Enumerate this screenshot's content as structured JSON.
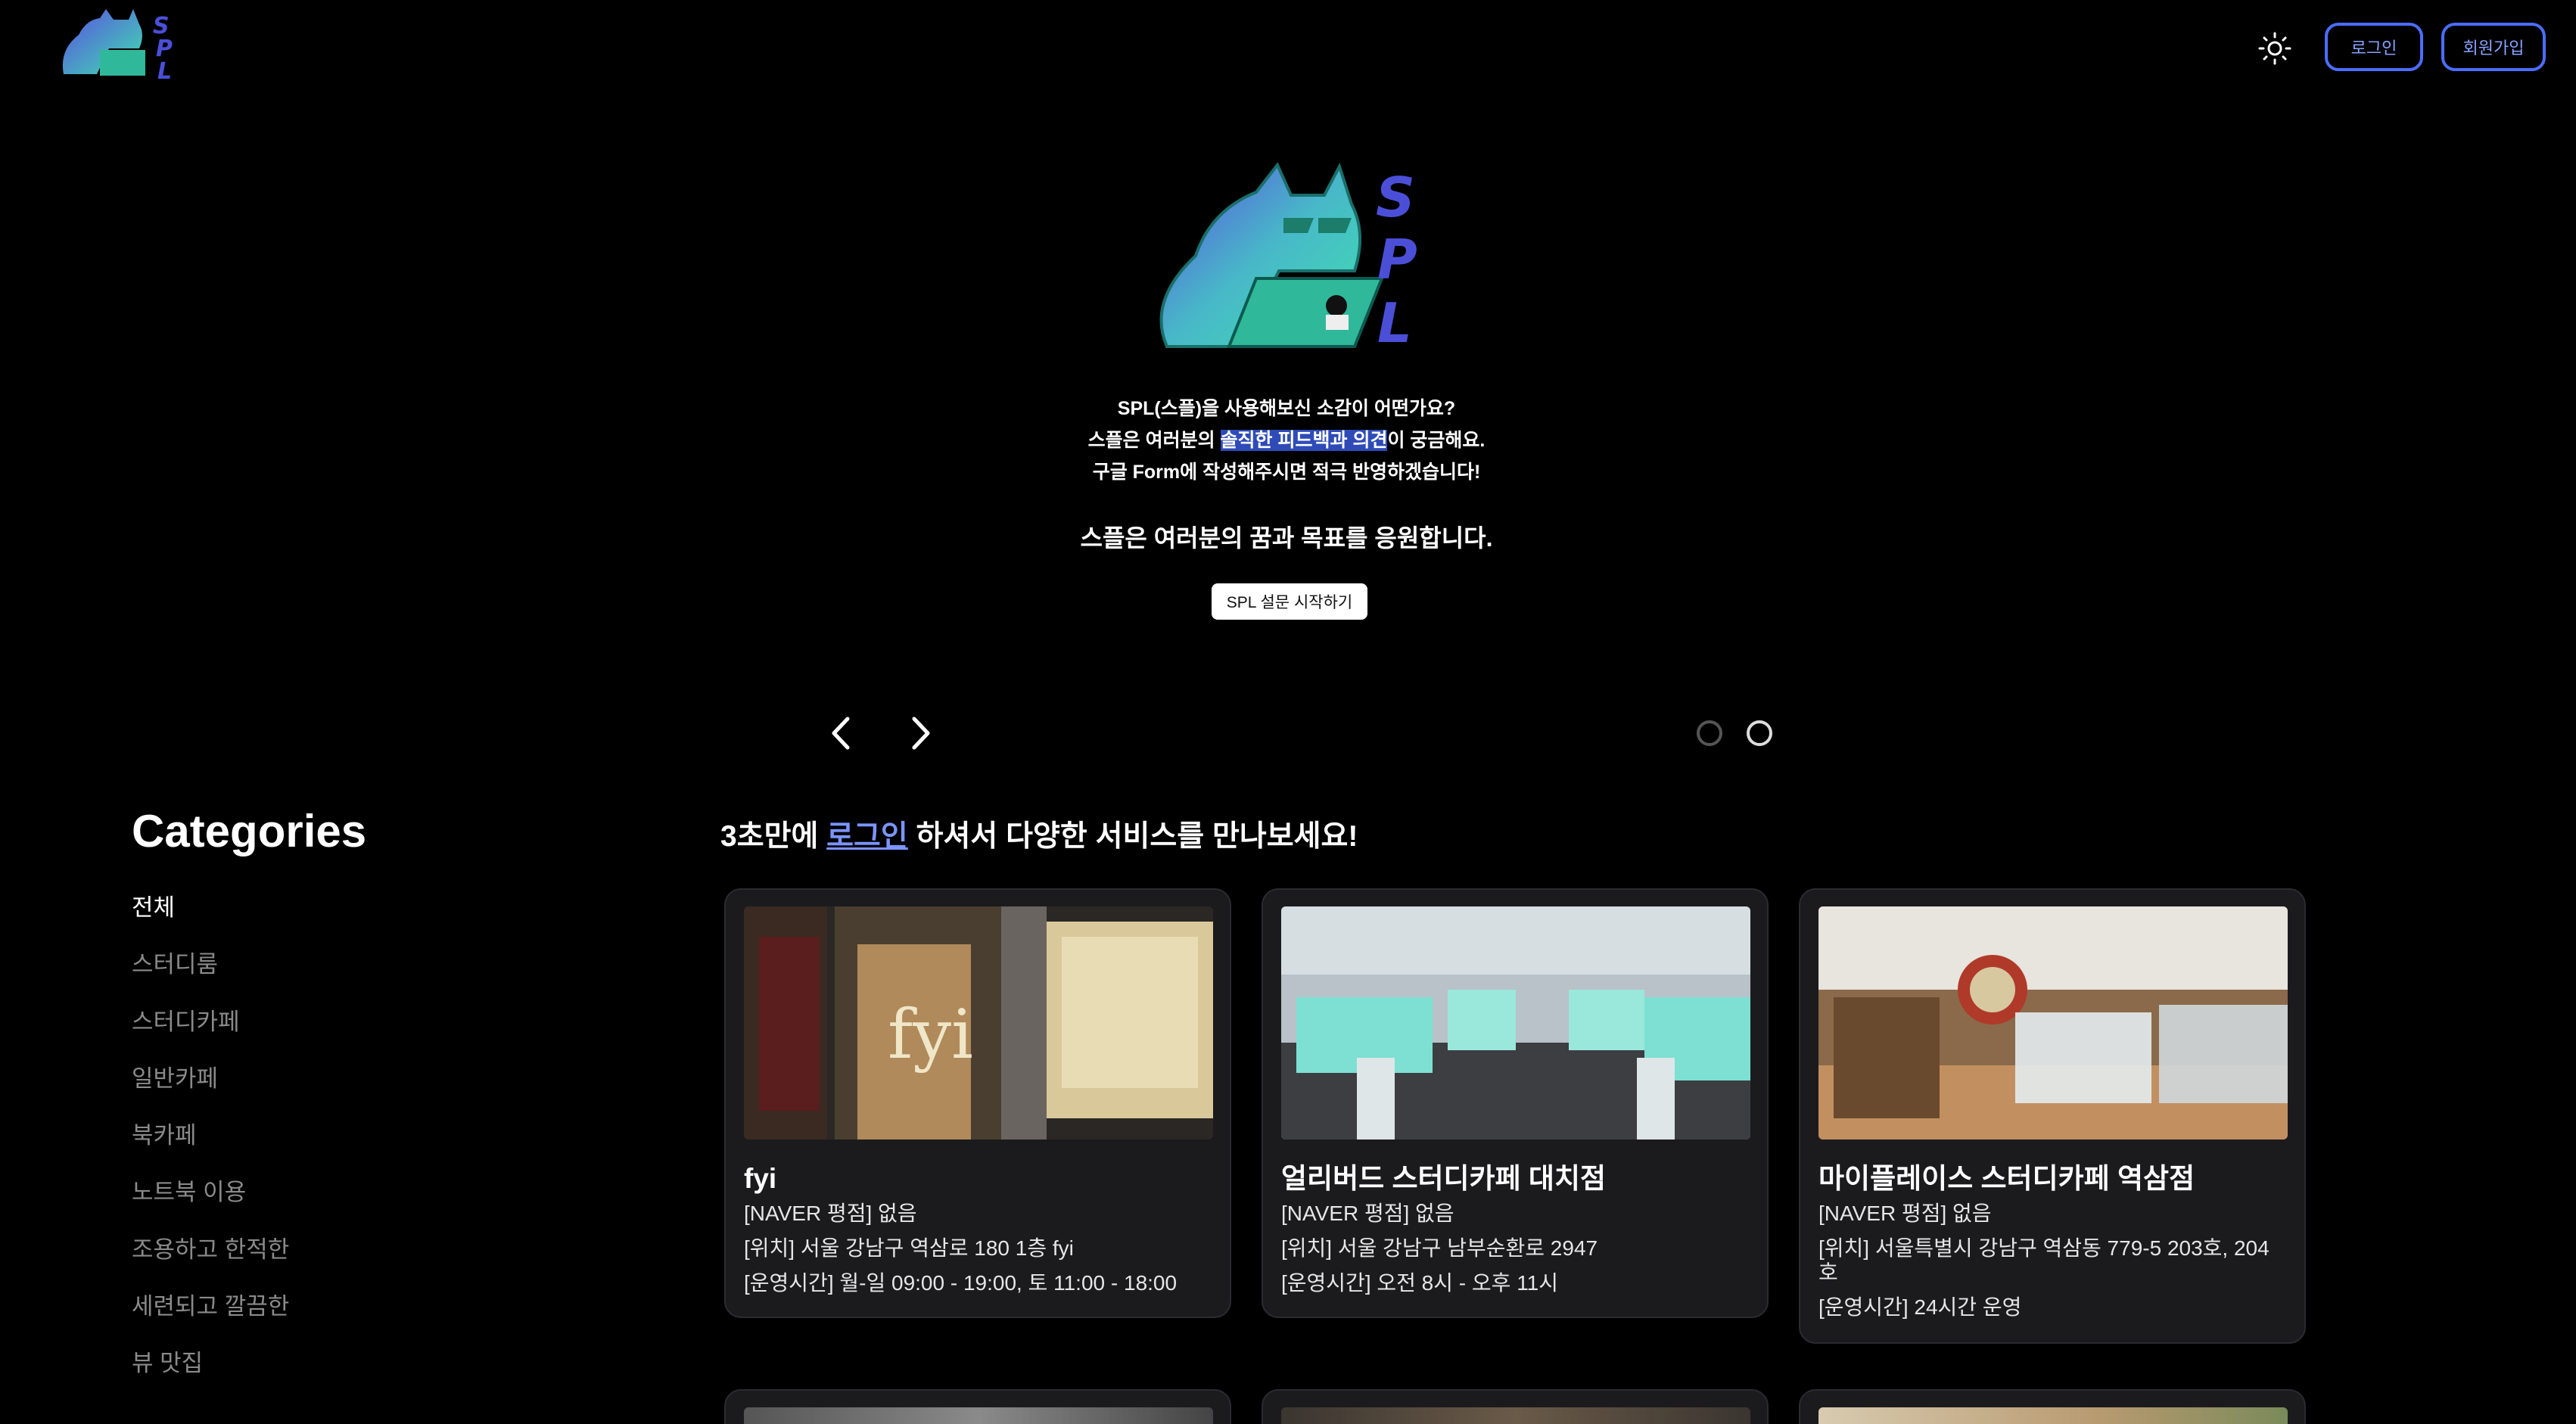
{
  "header": {
    "logo_icon": "spl-cat-logo",
    "theme_icon": "sun-icon",
    "login_label": "로그인",
    "signup_label": "회원가입"
  },
  "hero": {
    "line1": "SPL(스플)을 사용해보신 소감이 어떤가요?",
    "line2_pre": "스플은 여러분의 ",
    "line2_highlight": "솔직한 피드백과 의견",
    "line2_post": "이 궁금해요.",
    "line3": "구글 Form에 작성해주시면 적극 반영하겠습니다!",
    "line4": "스플은 여러분의 꿈과 목표를 응원합니다.",
    "survey_button": "SPL 설문 시작하기",
    "slide_count": 2,
    "active_slide": 2
  },
  "categories": {
    "title": "Categories",
    "items": [
      "전체",
      "스터디룸",
      "스터디카페",
      "일반카페",
      "북카페",
      "노트북 이용",
      "조용하고 한적한",
      "세련되고 깔끔한",
      "뷰 맛집"
    ],
    "active": "전체"
  },
  "promo": {
    "pre": "3초만에 ",
    "link": "로그인",
    "post": " 하셔서 다양한 서비스를 만나보세요!"
  },
  "places": [
    {
      "name": "fyi",
      "review": "[NAVER 평점] 없음",
      "location": "[위치] 서울 강남구 역삼로 180 1층 fyi",
      "hours": "[운영시간] 월-일 09:00 - 19:00, 토 11:00 - 18:00"
    },
    {
      "name": "얼리버드 스터디카페 대치점",
      "review": "[NAVER 평점] 없음",
      "location": "[위치] 서울 강남구 남부순환로 2947",
      "hours": "[운영시간] 오전 8시 - 오후 11시"
    },
    {
      "name": "마이플레이스 스터디카페 역삼점",
      "review": "[NAVER 평점] 없음",
      "location": "[위치] 서울특별시 강남구 역삼동 779-5 203호, 204호",
      "hours": "[운영시간] 24시간 운영"
    }
  ],
  "colors": {
    "background": "#000000",
    "accent_blue": "#4b6dff",
    "card_bg": "#1b1b1e",
    "logo_teal": "#4fd8b8",
    "logo_purple": "#4b4fd8"
  }
}
